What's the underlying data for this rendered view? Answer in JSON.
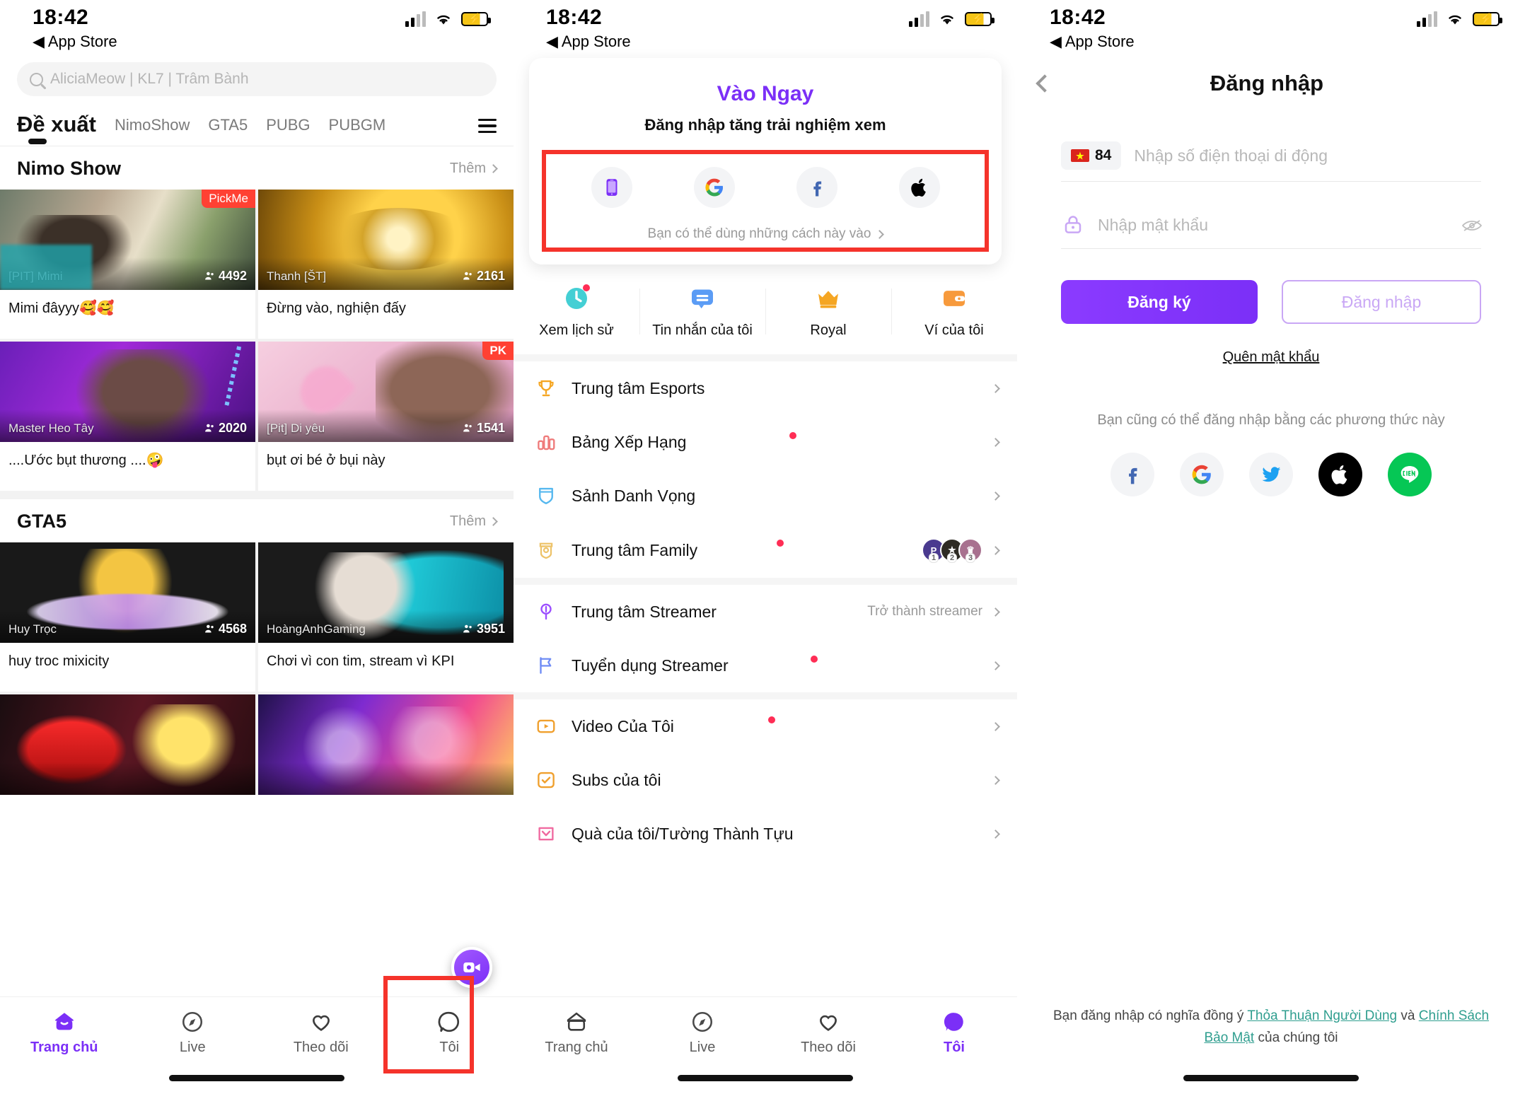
{
  "status_bar": {
    "time": "18:42",
    "back_label": "App Store"
  },
  "panel1": {
    "search": {
      "placeholder": "AliciaMeow | KL7 | Trâm Bành",
      "icon": "search-icon"
    },
    "tabs": [
      {
        "label": "Đề xuất",
        "active": true
      },
      {
        "label": "NimoShow",
        "active": false
      },
      {
        "label": "GTA5",
        "active": false
      },
      {
        "label": "PUBG",
        "active": false
      },
      {
        "label": "PUBGM",
        "active": false
      }
    ],
    "menu_icon": "hamburger-icon",
    "sections": [
      {
        "title": "Nimo Show",
        "more_label": "Thêm",
        "cards": [
          {
            "nick": "[PIT] Mimi",
            "viewers": "4492",
            "title": "Mimi đâyyy🥰🥰",
            "badge": "PickMe",
            "art": "a1"
          },
          {
            "nick": "Thanh [ŠT]",
            "viewers": "2161",
            "title": "Đừng vào, nghiện đấy",
            "badge": "",
            "art": "a2"
          },
          {
            "nick": "Master Heo Tây",
            "viewers": "2020",
            "title": "....Ước bụt thương  ....🤪",
            "badge": "",
            "art": "a3"
          },
          {
            "nick": "[Pit] Di yêu",
            "viewers": "1541",
            "title": "bụt ơi bé ở bụi này",
            "badge": "PK",
            "art": "a4"
          }
        ]
      },
      {
        "title": "GTA5",
        "more_label": "Thêm",
        "cards": [
          {
            "nick": "Huy Trọc",
            "viewers": "4568",
            "title": "huy troc mixicity",
            "badge": "",
            "art": "a5"
          },
          {
            "nick": "HoàngAnhGaming",
            "viewers": "3951",
            "title": "Chơi vì con tim, stream vì KPI",
            "badge": "",
            "art": "a6"
          },
          {
            "nick": "",
            "viewers": "",
            "title": "",
            "badge": "",
            "art": "a7"
          },
          {
            "nick": "",
            "viewers": "",
            "title": "",
            "badge": "",
            "art": "a8"
          }
        ]
      }
    ],
    "fab": "camera-live-icon",
    "bottom_nav": [
      {
        "label": "Trang chủ",
        "icon": "home-icon",
        "active": true
      },
      {
        "label": "Live",
        "icon": "compass-icon",
        "active": false
      },
      {
        "label": "Theo dõi",
        "icon": "heart-icon",
        "active": false
      },
      {
        "label": "Tôi",
        "icon": "profile-icon",
        "active": false
      }
    ],
    "highlight": "tab-toi-highlight"
  },
  "panel2": {
    "login_card": {
      "title": "Vào Ngay",
      "subtitle": "Đăng nhập tăng trải nghiệm xem",
      "socials": [
        {
          "name": "phone-icon"
        },
        {
          "name": "google-icon"
        },
        {
          "name": "facebook-icon"
        },
        {
          "name": "apple-icon"
        }
      ],
      "hint": "Bạn có thể dùng những cách này vào"
    },
    "quick_actions": [
      {
        "label": "Xem lịch sử",
        "icon": "clock-icon",
        "dot": true
      },
      {
        "label": "Tin nhắn của tôi",
        "icon": "message-icon",
        "dot": false
      },
      {
        "label": "Royal",
        "icon": "crown-icon",
        "dot": false
      },
      {
        "label": "Ví của tôi",
        "icon": "wallet-icon",
        "dot": false
      }
    ],
    "menu_groups": [
      [
        {
          "label": "Trung tâm Esports",
          "icon": "trophy-icon",
          "dot": false,
          "right_text": "",
          "avatars": []
        },
        {
          "label": "Bảng Xếp Hạng",
          "icon": "chart-icon",
          "dot": true,
          "right_text": "",
          "avatars": []
        },
        {
          "label": "Sảnh Danh Vọng",
          "icon": "shield-icon",
          "dot": false,
          "right_text": "",
          "avatars": []
        },
        {
          "label": "Trung tâm Family",
          "icon": "family-icon",
          "dot": true,
          "right_text": "",
          "avatars": [
            "1",
            "2",
            "3"
          ]
        }
      ],
      [
        {
          "label": "Trung tâm Streamer",
          "icon": "mic-icon",
          "dot": false,
          "right_text": "Trở thành streamer",
          "avatars": []
        },
        {
          "label": "Tuyển dụng Streamer",
          "icon": "flag-icon",
          "dot": true,
          "right_text": "",
          "avatars": []
        }
      ],
      [
        {
          "label": "Video Của Tôi",
          "icon": "video-icon",
          "dot": true,
          "right_text": "",
          "avatars": []
        },
        {
          "label": "Subs của tôi",
          "icon": "subs-icon",
          "dot": false,
          "right_text": "",
          "avatars": []
        },
        {
          "label": "Quà của tôi/Tường Thành Tựu",
          "icon": "gift-icon",
          "dot": false,
          "right_text": "",
          "avatars": []
        }
      ]
    ],
    "bottom_nav": [
      {
        "label": "Trang chủ",
        "icon": "home-icon",
        "active": false
      },
      {
        "label": "Live",
        "icon": "compass-icon",
        "active": false
      },
      {
        "label": "Theo dõi",
        "icon": "heart-icon",
        "active": false
      },
      {
        "label": "Tôi",
        "icon": "profile-icon",
        "active": true
      }
    ]
  },
  "panel3": {
    "title": "Đăng nhập",
    "back_icon": "back-chevron-icon",
    "country_code": "84",
    "phone_placeholder": "Nhập số điện thoại di động",
    "password_placeholder": "Nhập mật khẩu",
    "lock_icon": "lock-icon",
    "eye_icon": "eye-off-icon",
    "register_label": "Đăng ký",
    "login_label": "Đăng nhập",
    "forgot_label": "Quên mật khẩu",
    "other_methods_label": "Bạn cũng có thể đăng nhập bằng các phương thức này",
    "socials": [
      {
        "name": "facebook-icon"
      },
      {
        "name": "google-icon"
      },
      {
        "name": "twitter-icon"
      },
      {
        "name": "apple-icon"
      },
      {
        "name": "line-icon"
      }
    ],
    "footer": {
      "prefix": "Bạn đăng nhập có nghĩa đồng ý ",
      "link1": "Thỏa Thuận Người Dùng",
      "middle": " và ",
      "link2": "Chính Sách Bảo Mật",
      "suffix": " của chúng tôi"
    }
  },
  "colors": {
    "accent": "#7b2ff7",
    "highlight": "#f5332b",
    "badge": "#ff4133",
    "link": "#2f9e8f"
  }
}
